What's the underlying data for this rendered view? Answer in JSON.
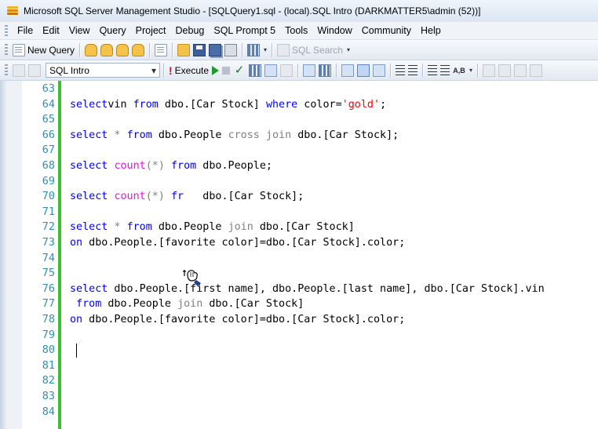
{
  "window": {
    "title": "Microsoft SQL Server Management Studio - [SQLQuery1.sql - (local).SQL Intro (DARKMATTER5\\admin (52))]"
  },
  "menu": [
    "File",
    "Edit",
    "View",
    "Query",
    "Project",
    "Debug",
    "SQL Prompt 5",
    "Tools",
    "Window",
    "Community",
    "Help"
  ],
  "toolbar1": {
    "new_query_label": "New Query",
    "sql_search_label": "SQL Search"
  },
  "toolbar2": {
    "database_value": "SQL Intro",
    "execute_label": "Execute"
  },
  "editor": {
    "line_numbers": [
      "63",
      "64",
      "65",
      "66",
      "67",
      "68",
      "69",
      "70",
      "71",
      "72",
      "73",
      "74",
      "75",
      "76",
      "77",
      "78",
      "79",
      "80",
      "81",
      "82",
      "83",
      "84"
    ],
    "lines": [
      [],
      [
        [
          "kw",
          "select"
        ],
        [
          "",
          "vin "
        ],
        [
          "kw",
          "from"
        ],
        [
          "",
          " dbo.[Car Stock] "
        ],
        [
          "kw",
          "where"
        ],
        [
          "",
          " color="
        ],
        [
          "str",
          "'gold'"
        ],
        [
          "",
          ";"
        ]
      ],
      [],
      [
        [
          "kw",
          "select"
        ],
        [
          "gray",
          " *"
        ],
        [
          "",
          " "
        ],
        [
          "kw",
          "from"
        ],
        [
          "",
          " dbo.People "
        ],
        [
          "gray",
          "cross join"
        ],
        [
          "",
          " dbo.[Car Stock];"
        ]
      ],
      [],
      [
        [
          "kw",
          "select"
        ],
        [
          "",
          " "
        ],
        [
          "fn",
          "count"
        ],
        [
          "gray",
          "(*)"
        ],
        [
          "",
          " "
        ],
        [
          "kw",
          "from"
        ],
        [
          "",
          " dbo.People;"
        ]
      ],
      [],
      [
        [
          "kw",
          "select"
        ],
        [
          "",
          " "
        ],
        [
          "fn",
          "count"
        ],
        [
          "gray",
          "(*)"
        ],
        [
          "",
          " "
        ],
        [
          "kw",
          "fr"
        ],
        [
          "",
          "   dbo.[Car Stock];"
        ]
      ],
      [],
      [
        [
          "kw",
          "select"
        ],
        [
          "gray",
          " *"
        ],
        [
          "",
          " "
        ],
        [
          "kw",
          "from"
        ],
        [
          "",
          " dbo.People "
        ],
        [
          "gray",
          "join"
        ],
        [
          "",
          " dbo.[Car Stock]"
        ]
      ],
      [
        [
          "kw",
          "on"
        ],
        [
          "",
          " dbo.People.[favorite color]=dbo.[Car Stock].color;"
        ]
      ],
      [],
      [],
      [
        [
          "kw",
          "select"
        ],
        [
          "",
          " dbo.People.[first name], dbo.People.[last name], dbo.[Car Stock].vin"
        ]
      ],
      [
        [
          "",
          " "
        ],
        [
          "kw",
          "from"
        ],
        [
          "",
          " dbo.People "
        ],
        [
          "gray",
          "join"
        ],
        [
          "",
          " dbo.[Car Stock]"
        ]
      ],
      [
        [
          "kw",
          "on"
        ],
        [
          "",
          " dbo.People.[favorite color]=dbo.[Car Stock].color;"
        ]
      ],
      [],
      [],
      [],
      [],
      [],
      []
    ]
  },
  "colors": {
    "keyword": "#0000ff",
    "string": "#ff0000",
    "function": "#ff00ff",
    "operator": "#808080",
    "line_number": "#2b91af",
    "change_bar": "#3fbf2f"
  }
}
